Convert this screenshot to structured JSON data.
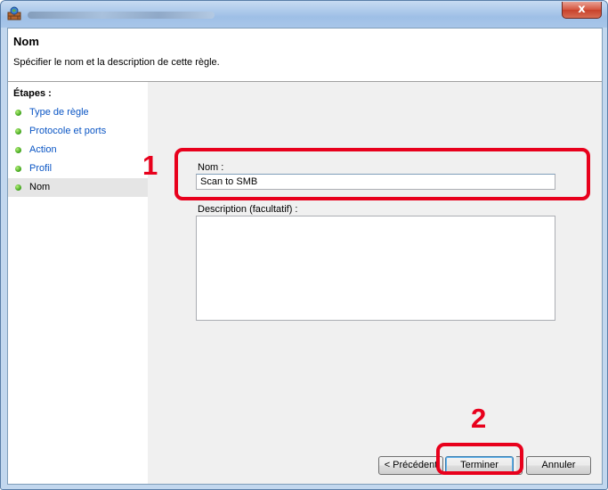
{
  "titlebar": {
    "close_label": "x",
    "app_icon": "firewall-icon"
  },
  "header": {
    "title": "Nom",
    "subtitle": "Spécifier le nom et la description de cette règle."
  },
  "sidebar": {
    "heading": "Étapes :",
    "items": [
      {
        "label": "Type de règle"
      },
      {
        "label": "Protocole et ports"
      },
      {
        "label": "Action"
      },
      {
        "label": "Profil"
      },
      {
        "label": "Nom",
        "current": true
      }
    ]
  },
  "form": {
    "name_label": "Nom :",
    "name_value": "Scan to SMB",
    "description_label": "Description (facultatif) :",
    "description_value": ""
  },
  "buttons": {
    "previous": "< Précédent",
    "finish": "Terminer",
    "cancel": "Annuler"
  },
  "callouts": {
    "one": "1",
    "two": "2"
  },
  "colors": {
    "callout": "#e8001c",
    "link": "#0a55c4",
    "step_dot": "#3aa018"
  }
}
